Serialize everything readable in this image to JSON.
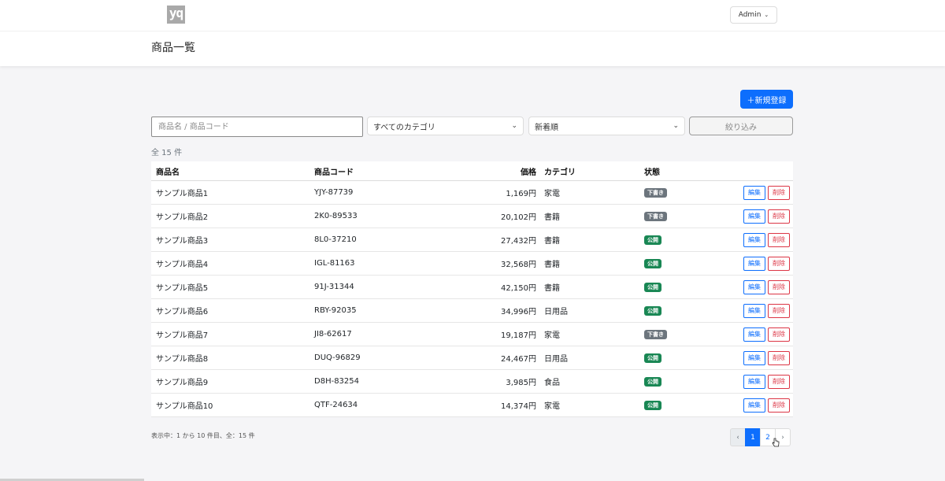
{
  "header": {
    "logo_text": "yq",
    "admin_label": "Admin",
    "page_title": "商品一覧"
  },
  "toolbar": {
    "new_button": "＋新規登録",
    "search_placeholder": "商品名 / 商品コード",
    "category_select": "すべてのカテゴリ",
    "sort_select": "新着順",
    "filter_button": "絞り込み",
    "total_count": "全 15 件"
  },
  "table": {
    "headers": {
      "name": "商品名",
      "code": "商品コード",
      "price": "価格",
      "category": "カテゴリ",
      "status": "状態"
    },
    "edit_label": "編集",
    "delete_label": "削除",
    "rows": [
      {
        "name": "サンプル商品1",
        "code": "YJY-87739",
        "price": "1,169円",
        "category": "家電",
        "status": "下書き",
        "status_type": "draft"
      },
      {
        "name": "サンプル商品2",
        "code": "2K0-89533",
        "price": "20,102円",
        "category": "書籍",
        "status": "下書き",
        "status_type": "draft"
      },
      {
        "name": "サンプル商品3",
        "code": "8L0-37210",
        "price": "27,432円",
        "category": "書籍",
        "status": "公開",
        "status_type": "public"
      },
      {
        "name": "サンプル商品4",
        "code": "IGL-81163",
        "price": "32,568円",
        "category": "書籍",
        "status": "公開",
        "status_type": "public"
      },
      {
        "name": "サンプル商品5",
        "code": "91J-31344",
        "price": "42,150円",
        "category": "書籍",
        "status": "公開",
        "status_type": "public"
      },
      {
        "name": "サンプル商品6",
        "code": "RBY-92035",
        "price": "34,996円",
        "category": "日用品",
        "status": "公開",
        "status_type": "public"
      },
      {
        "name": "サンプル商品7",
        "code": "JI8-62617",
        "price": "19,187円",
        "category": "家電",
        "status": "下書き",
        "status_type": "draft"
      },
      {
        "name": "サンプル商品8",
        "code": "DUQ-96829",
        "price": "24,467円",
        "category": "日用品",
        "status": "公開",
        "status_type": "public"
      },
      {
        "name": "サンプル商品9",
        "code": "D8H-83254",
        "price": "3,985円",
        "category": "食品",
        "status": "公開",
        "status_type": "public"
      },
      {
        "name": "サンプル商品10",
        "code": "QTF-24634",
        "price": "14,374円",
        "category": "家電",
        "status": "公開",
        "status_type": "public"
      }
    ]
  },
  "footer": {
    "showing_text": "表示中：1 から 10 件目、全：15 件",
    "pages": {
      "prev": "‹",
      "p1": "1",
      "p2": "2",
      "next": "›"
    },
    "current_page": 1
  },
  "colors": {
    "primary": "#0d6efd",
    "danger": "#dc3545",
    "draft": "#6c757d",
    "public": "#198754"
  }
}
